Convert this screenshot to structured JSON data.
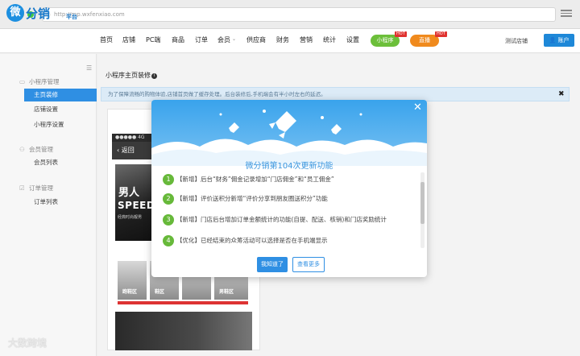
{
  "browser": {
    "url": "http://mp.wxfenxiao.com"
  },
  "brand": {
    "logo_mark": "微",
    "name": "分销",
    "sub": "平台"
  },
  "nav": {
    "items": [
      "首页",
      "店铺",
      "PC端",
      "商品",
      "订单",
      "会员",
      "供应商",
      "财务",
      "营销",
      "统计",
      "设置"
    ],
    "mini_program": "小程序",
    "live": "直播",
    "hot": "HOT",
    "store_label": "测试店铺",
    "account": "账户"
  },
  "sidebar": {
    "groups": [
      {
        "label": "小程序管理",
        "icon": "monitor-icon",
        "items": [
          "主页装修",
          "店铺设置",
          "小程序设置"
        ]
      },
      {
        "label": "会员管理",
        "icon": "users-icon",
        "items": [
          "会员列表"
        ]
      },
      {
        "label": "订单管理",
        "icon": "checklist-icon",
        "items": [
          "订单列表"
        ]
      }
    ],
    "active": "主页装修"
  },
  "main": {
    "title": "小程序主页装修",
    "notice": "为了保障流畅的购物体验,店铺首页做了缓存处理。后台装修后,手机端会有半小时左右的延迟。",
    "phone": {
      "signal": "●●●●● 4G",
      "back": "返回",
      "banner_line1": "男人",
      "banner_line2": "SPEED",
      "banner_line3": "经典时尚靓男",
      "tiles": [
        "跑鞋区",
        "鞋区",
        "",
        "男鞋区"
      ]
    }
  },
  "modal": {
    "title": "微分销第104次更新功能",
    "items": [
      {
        "num": "1",
        "text": "【新增】后台“财务”佣金记录增加“门店佣金”和“员工佣金”"
      },
      {
        "num": "2",
        "text": "【新增】评价送积分新增“评价分享到朋友圈送积分”功能"
      },
      {
        "num": "3",
        "text": "【新增】门店后台增加订单金额统计的功能(自提、配送、核销)和门店奖励统计"
      },
      {
        "num": "4",
        "text": "【优化】已经结束的众筹活动可以选择是否在手机端显示"
      }
    ],
    "ok": "我知道了",
    "more": "查看更多"
  },
  "watermark": "大数跨境",
  "colors": {
    "primary": "#2f8fe3",
    "green": "#67b93a",
    "orange": "#f08a1d"
  }
}
